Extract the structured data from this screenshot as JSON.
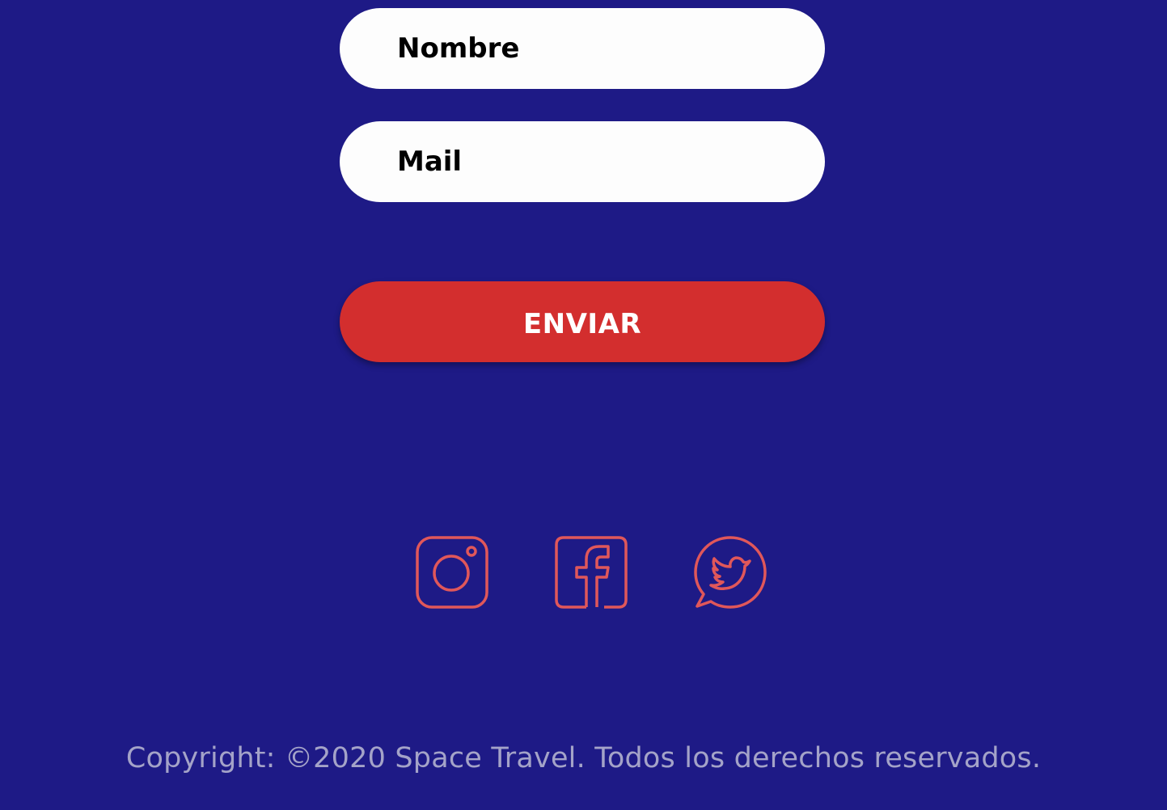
{
  "form": {
    "name_placeholder": "Nombre",
    "mail_placeholder": "Mail",
    "submit_label": "ENVIAR"
  },
  "social": [
    {
      "icon": "instagram-icon"
    },
    {
      "icon": "facebook-icon"
    },
    {
      "icon": "twitter-icon"
    }
  ],
  "footer": {
    "copyright": "Copyright: ©2020 Space Travel. Todos los derechos reservados."
  },
  "colors": {
    "background": "#1e1a86",
    "button": "#d32e2e",
    "icon_stroke": "#e0575a",
    "input_bg": "#fdfdfd",
    "footer_text": "#a4a3c8"
  }
}
